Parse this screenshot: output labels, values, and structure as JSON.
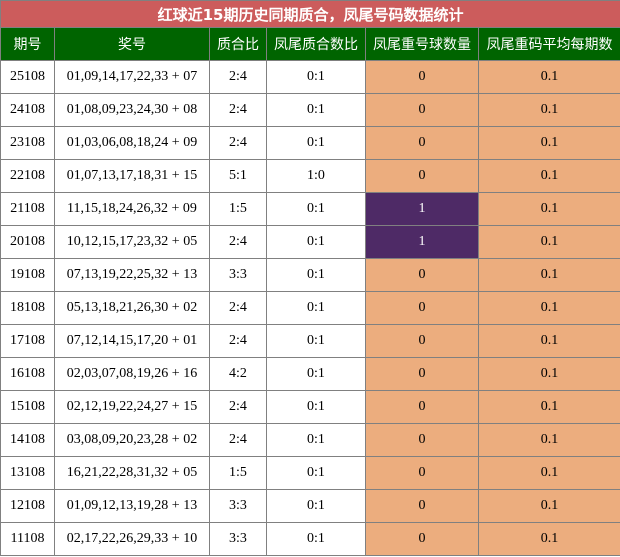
{
  "title": "红球近15期历史同期质合，凤尾号码数据统计",
  "headers": [
    "期号",
    "奖号",
    "质合比",
    "凤尾质合数比",
    "凤尾重号球数量",
    "凤尾重码平均每期数"
  ],
  "colors": {
    "title_bg": "#cc5c5c",
    "header_bg": "#006400",
    "orange": "#ecad7e",
    "purple": "#4e2a66"
  },
  "rows": [
    {
      "issue": "25108",
      "numbers": "01,09,14,17,22,33 + 07",
      "ratio": "2:4",
      "tail_ratio": "0:1",
      "repeat_count": "0",
      "avg": "0.1"
    },
    {
      "issue": "24108",
      "numbers": "01,08,09,23,24,30 + 08",
      "ratio": "2:4",
      "tail_ratio": "0:1",
      "repeat_count": "0",
      "avg": "0.1"
    },
    {
      "issue": "23108",
      "numbers": "01,03,06,08,18,24 + 09",
      "ratio": "2:4",
      "tail_ratio": "0:1",
      "repeat_count": "0",
      "avg": "0.1"
    },
    {
      "issue": "22108",
      "numbers": "01,07,13,17,18,31 + 15",
      "ratio": "5:1",
      "tail_ratio": "1:0",
      "repeat_count": "0",
      "avg": "0.1"
    },
    {
      "issue": "21108",
      "numbers": "11,15,18,24,26,32 + 09",
      "ratio": "1:5",
      "tail_ratio": "0:1",
      "repeat_count": "1",
      "avg": "0.1"
    },
    {
      "issue": "20108",
      "numbers": "10,12,15,17,23,32 + 05",
      "ratio": "2:4",
      "tail_ratio": "0:1",
      "repeat_count": "1",
      "avg": "0.1"
    },
    {
      "issue": "19108",
      "numbers": "07,13,19,22,25,32 + 13",
      "ratio": "3:3",
      "tail_ratio": "0:1",
      "repeat_count": "0",
      "avg": "0.1"
    },
    {
      "issue": "18108",
      "numbers": "05,13,18,21,26,30 + 02",
      "ratio": "2:4",
      "tail_ratio": "0:1",
      "repeat_count": "0",
      "avg": "0.1"
    },
    {
      "issue": "17108",
      "numbers": "07,12,14,15,17,20 + 01",
      "ratio": "2:4",
      "tail_ratio": "0:1",
      "repeat_count": "0",
      "avg": "0.1"
    },
    {
      "issue": "16108",
      "numbers": "02,03,07,08,19,26 + 16",
      "ratio": "4:2",
      "tail_ratio": "0:1",
      "repeat_count": "0",
      "avg": "0.1"
    },
    {
      "issue": "15108",
      "numbers": "02,12,19,22,24,27 + 15",
      "ratio": "2:4",
      "tail_ratio": "0:1",
      "repeat_count": "0",
      "avg": "0.1"
    },
    {
      "issue": "14108",
      "numbers": "03,08,09,20,23,28 + 02",
      "ratio": "2:4",
      "tail_ratio": "0:1",
      "repeat_count": "0",
      "avg": "0.1"
    },
    {
      "issue": "13108",
      "numbers": "16,21,22,28,31,32 + 05",
      "ratio": "1:5",
      "tail_ratio": "0:1",
      "repeat_count": "0",
      "avg": "0.1"
    },
    {
      "issue": "12108",
      "numbers": "01,09,12,13,19,28 + 13",
      "ratio": "3:3",
      "tail_ratio": "0:1",
      "repeat_count": "0",
      "avg": "0.1"
    },
    {
      "issue": "11108",
      "numbers": "02,17,22,26,29,33 + 10",
      "ratio": "3:3",
      "tail_ratio": "0:1",
      "repeat_count": "0",
      "avg": "0.1"
    }
  ]
}
